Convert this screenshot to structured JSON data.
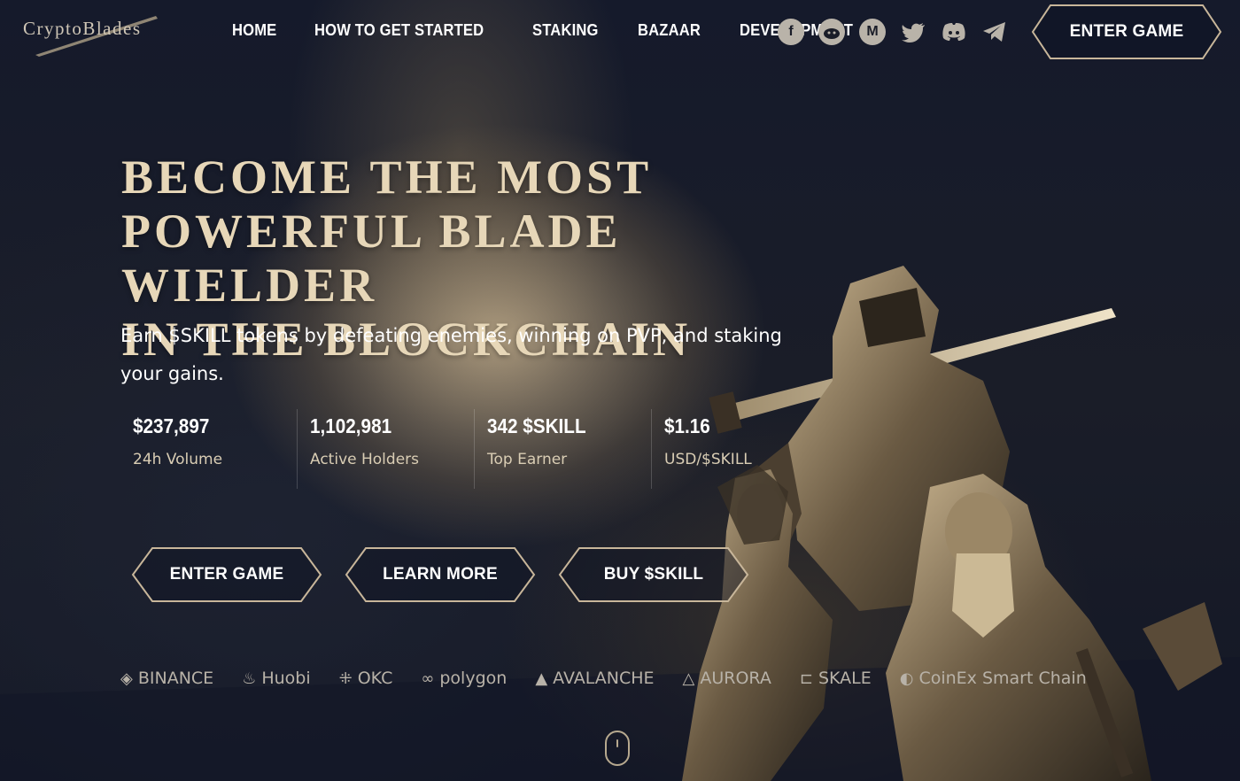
{
  "header": {
    "logo_text": "CryptoBlades",
    "nav": [
      "HOME",
      "HOW TO GET STARTED",
      "STAKING",
      "BAZAAR",
      "DEVELOPMENT"
    ],
    "socials": [
      {
        "icon": "facebook-icon",
        "glyph": "f"
      },
      {
        "icon": "reddit-icon",
        "glyph": "●"
      },
      {
        "icon": "medium-icon",
        "glyph": "M"
      },
      {
        "icon": "twitter-icon",
        "glyph": "🐦"
      },
      {
        "icon": "discord-icon",
        "glyph": "◼"
      },
      {
        "icon": "telegram-icon",
        "glyph": "➤"
      }
    ],
    "cta": "ENTER GAME"
  },
  "hero": {
    "headline": [
      "BECOME THE MOST",
      "POWERFUL BLADE WIELDER",
      "IN THE BLOCKCHAIN"
    ],
    "subtitle": "Earn $SKILL tokens by defeating enemies, winning on PVP, and staking your gains.",
    "stats": [
      {
        "value": "$237,897",
        "label": "24h Volume"
      },
      {
        "value": "1,102,981",
        "label": "Active Holders"
      },
      {
        "value": "342 $SKILL",
        "label": "Top Earner"
      },
      {
        "value": "$1.16",
        "label": "USD/$SKILL"
      }
    ],
    "buttons": [
      "ENTER GAME",
      "LEARN MORE",
      "BUY $SKILL"
    ]
  },
  "partners": [
    {
      "name": "BINANCE",
      "glyph": "◈"
    },
    {
      "name": "Huobi",
      "glyph": "♨"
    },
    {
      "name": "OKC",
      "glyph": "⁜"
    },
    {
      "name": "polygon",
      "glyph": "∞"
    },
    {
      "name": "AVALANCHE",
      "glyph": "▲"
    },
    {
      "name": "AURORA",
      "glyph": "△"
    },
    {
      "name": "SKALE",
      "glyph": "⊏"
    },
    {
      "name": "CoinEx Smart Chain",
      "glyph": "◐"
    }
  ],
  "colors": {
    "accent": "#e7d7b8",
    "background": "#0f1424",
    "button_border": "#c8b69a"
  }
}
